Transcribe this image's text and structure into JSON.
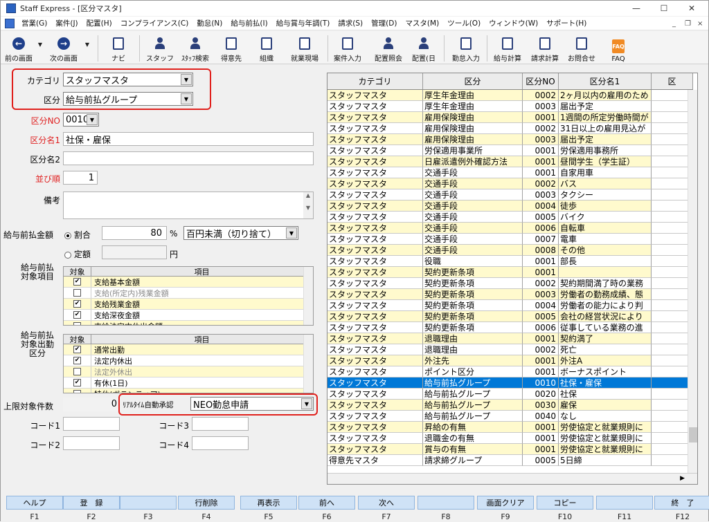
{
  "window": {
    "title": "Staff Express - [区分マスタ]",
    "min": "—",
    "max": "☐",
    "close": "✕"
  },
  "mdi": {
    "min": "_",
    "restore": "❐",
    "close": "×"
  },
  "menu": [
    "営業(G)",
    "案件(J)",
    "配置(H)",
    "コンプライアンス(C)",
    "勤怠(N)",
    "給与前払(I)",
    "給与賞与年調(T)",
    "請求(S)",
    "管理(D)",
    "マスタ(M)",
    "ツール(O)",
    "ウィンドウ(W)",
    "サポート(H)"
  ],
  "toolbar": {
    "prev": "前の画面",
    "next": "次の画面",
    "navi": "ナビ",
    "staff": "スタッフ",
    "staff_search": "ｽﾀｯﾌ検索",
    "client": "得意先",
    "org": "組織",
    "site": "就業現場",
    "case_input": "案件入力",
    "assign_view": "配置照会",
    "assign_day": "配置(日",
    "attend_input": "勤怠入力",
    "pay_calc": "給与計算",
    "bill_calc": "請求計算",
    "contact": "お問合せ",
    "faq": "FAQ",
    "faq_icon": "FAQ"
  },
  "form": {
    "category_label": "カテゴリ",
    "category_value": "スタッフマスタ",
    "kubun_label": "区分",
    "kubun_value": "給与前払グループ",
    "kubun_no_label": "区分NO",
    "kubun_no_value": "0010",
    "name1_label": "区分名1",
    "name1_value": "社保・雇保",
    "name2_label": "区分名2",
    "name2_value": "",
    "order_label": "並び順",
    "order_value": "1",
    "note_label": "備考",
    "note_value": "",
    "advance_label": "給与前払金額",
    "ratio_label": "割合",
    "ratio_value": "80",
    "percent": "%",
    "rounding_value": "百円未満（切り捨て）",
    "fixed_label": "定額",
    "fixed_value": "",
    "yen": "円",
    "target_items_label": "給与前払\n対象項目",
    "target_attend_label": "給与前払\n対象出勤\n区分",
    "col_target": "対象",
    "col_item": "項目",
    "limit_label": "上限対象件数",
    "limit_value": "0",
    "realtime_label": "ﾘｱﾙﾀｲﾑ自動承認",
    "realtime_value": "NEO勤怠申請",
    "code1_label": "コード1",
    "code2_label": "コード2",
    "code3_label": "コード3",
    "code4_label": "コード4",
    "code1": "",
    "code2": "",
    "code3": "",
    "code4": ""
  },
  "items": [
    {
      "checked": true,
      "label": "支給基本金額",
      "gray": false
    },
    {
      "checked": false,
      "label": "支給(所定内)残業金額",
      "gray": true
    },
    {
      "checked": true,
      "label": "支給残業金額",
      "gray": false
    },
    {
      "checked": true,
      "label": "支給深夜金額",
      "gray": false
    },
    {
      "checked": false,
      "label": "支給法定内休出金額",
      "gray": false
    }
  ],
  "attend": [
    {
      "checked": true,
      "label": "通常出勤",
      "gray": false
    },
    {
      "checked": true,
      "label": "法定内休出",
      "gray": false
    },
    {
      "checked": false,
      "label": "法定外休出",
      "gray": true
    },
    {
      "checked": true,
      "label": "有休(1日)",
      "gray": false
    },
    {
      "checked": false,
      "label": "特休(ボランティア)",
      "gray": false
    }
  ],
  "grid": {
    "headers": [
      "カテゴリ",
      "区分",
      "区分NO",
      "区分名1",
      "区"
    ],
    "rows": [
      [
        "スタッフマスタ",
        "厚生年金理由",
        "0002",
        "2ヶ月以内の雇用のため"
      ],
      [
        "スタッフマスタ",
        "厚生年金理由",
        "0003",
        "届出予定"
      ],
      [
        "スタッフマスタ",
        "雇用保険理由",
        "0001",
        "1週間の所定労働時間が"
      ],
      [
        "スタッフマスタ",
        "雇用保険理由",
        "0002",
        "31日以上の雇用見込が"
      ],
      [
        "スタッフマスタ",
        "雇用保険理由",
        "0003",
        "届出予定"
      ],
      [
        "スタッフマスタ",
        "労保適用事業所",
        "0001",
        "労保適用事務所"
      ],
      [
        "スタッフマスタ",
        "日雇派遣例外確認方法",
        "0001",
        "昼間学生（学生証）"
      ],
      [
        "スタッフマスタ",
        "交通手段",
        "0001",
        "自家用車"
      ],
      [
        "スタッフマスタ",
        "交通手段",
        "0002",
        "バス"
      ],
      [
        "スタッフマスタ",
        "交通手段",
        "0003",
        "タクシー"
      ],
      [
        "スタッフマスタ",
        "交通手段",
        "0004",
        "徒歩"
      ],
      [
        "スタッフマスタ",
        "交通手段",
        "0005",
        "バイク"
      ],
      [
        "スタッフマスタ",
        "交通手段",
        "0006",
        "自転車"
      ],
      [
        "スタッフマスタ",
        "交通手段",
        "0007",
        "電車"
      ],
      [
        "スタッフマスタ",
        "交通手段",
        "0008",
        "その他"
      ],
      [
        "スタッフマスタ",
        "役職",
        "0001",
        "部長"
      ],
      [
        "スタッフマスタ",
        "契約更新条項",
        "0001",
        ""
      ],
      [
        "スタッフマスタ",
        "契約更新条項",
        "0002",
        "契約期間満了時の業務"
      ],
      [
        "スタッフマスタ",
        "契約更新条項",
        "0003",
        "労働者の勤務成績、態"
      ],
      [
        "スタッフマスタ",
        "契約更新条項",
        "0004",
        "労働者の能力により判"
      ],
      [
        "スタッフマスタ",
        "契約更新条項",
        "0005",
        "会社の経営状況により"
      ],
      [
        "スタッフマスタ",
        "契約更新条項",
        "0006",
        "従事している業務の進"
      ],
      [
        "スタッフマスタ",
        "退職理由",
        "0001",
        "契約満了"
      ],
      [
        "スタッフマスタ",
        "退職理由",
        "0002",
        "死亡"
      ],
      [
        "スタッフマスタ",
        "外注先",
        "0001",
        "外注A"
      ],
      [
        "スタッフマスタ",
        "ポイント区分",
        "0001",
        "ボーナスポイント"
      ],
      [
        "スタッフマスタ",
        "給与前払グループ",
        "0010",
        "社保・雇保"
      ],
      [
        "スタッフマスタ",
        "給与前払グループ",
        "0020",
        "社保"
      ],
      [
        "スタッフマスタ",
        "給与前払グループ",
        "0030",
        "雇保"
      ],
      [
        "スタッフマスタ",
        "給与前払グループ",
        "0040",
        "なし"
      ],
      [
        "スタッフマスタ",
        "昇給の有無",
        "0001",
        "労使協定と就業規則に"
      ],
      [
        "スタッフマスタ",
        "退職金の有無",
        "0001",
        "労使協定と就業規則に"
      ],
      [
        "スタッフマスタ",
        "賞与の有無",
        "0001",
        "労使協定と就業規則に"
      ],
      [
        "得意先マスタ",
        "請求締グループ",
        "0005",
        "5日締"
      ]
    ],
    "selected_index": 26
  },
  "fkeys": [
    {
      "label": "ヘルプ",
      "key": "F1"
    },
    {
      "label": "登　録",
      "key": "F2"
    },
    {
      "label": "",
      "key": "F3"
    },
    {
      "label": "行削除",
      "key": "F4"
    },
    {
      "label": "再表示",
      "key": "F5"
    },
    {
      "label": "前へ",
      "key": "F6"
    },
    {
      "label": "次へ",
      "key": "F7"
    },
    {
      "label": "",
      "key": "F8"
    },
    {
      "label": "画面クリア",
      "key": "F9"
    },
    {
      "label": "コピー",
      "key": "F10"
    },
    {
      "label": "",
      "key": "F11"
    },
    {
      "label": "終　了",
      "key": "F12"
    }
  ],
  "colors": {
    "row_yellow": "#fffacd",
    "selected": "#0078d7",
    "highlight_box": "#e0201c",
    "fkey_bg": "#cfe2f6"
  }
}
